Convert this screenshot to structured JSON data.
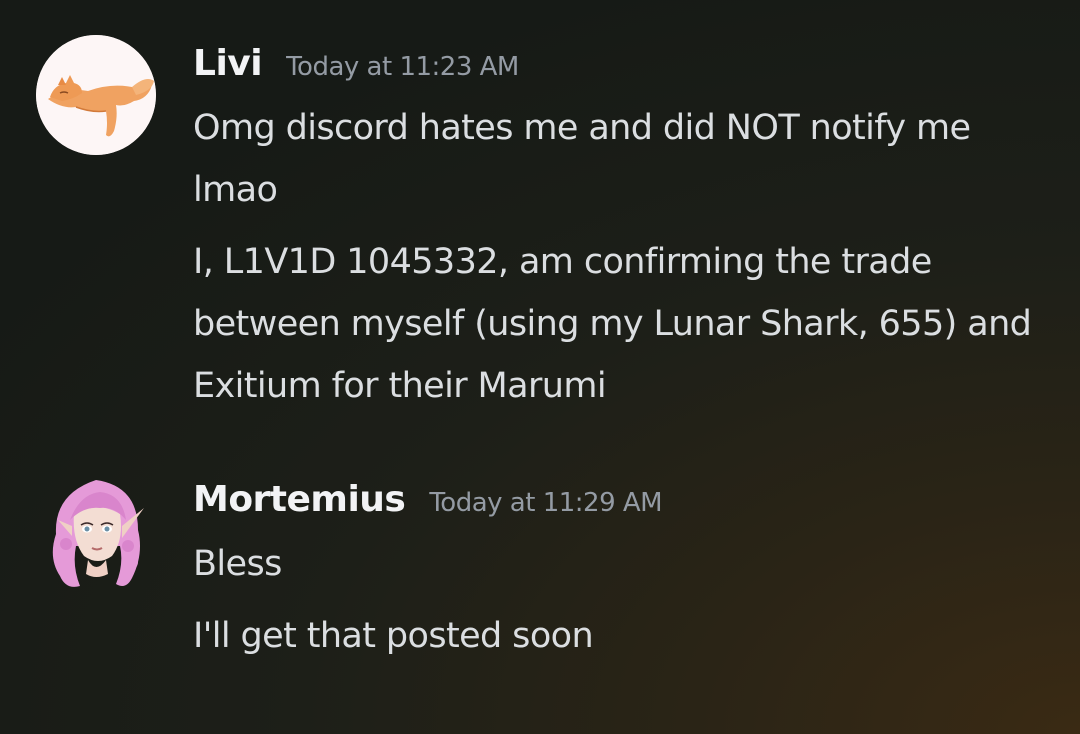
{
  "messages": [
    {
      "username": "Livi",
      "timestamp": "Today at 11:23 AM",
      "lines": [
        "Omg discord hates me and did NOT notify me lmao",
        "I, L1V1D 1045332, am confirming the trade between myself (using my Lunar Shark, 655) and Exitium for their Marumi"
      ],
      "avatar_icon": "fox-icon",
      "avatar_bg": "#fdf6f6"
    },
    {
      "username": "Mortemius",
      "timestamp": "Today at 11:29 AM",
      "lines": [
        "Bless",
        "I'll get that posted soon"
      ],
      "avatar_icon": "elf-girl-icon",
      "avatar_bg": "transparent"
    }
  ]
}
